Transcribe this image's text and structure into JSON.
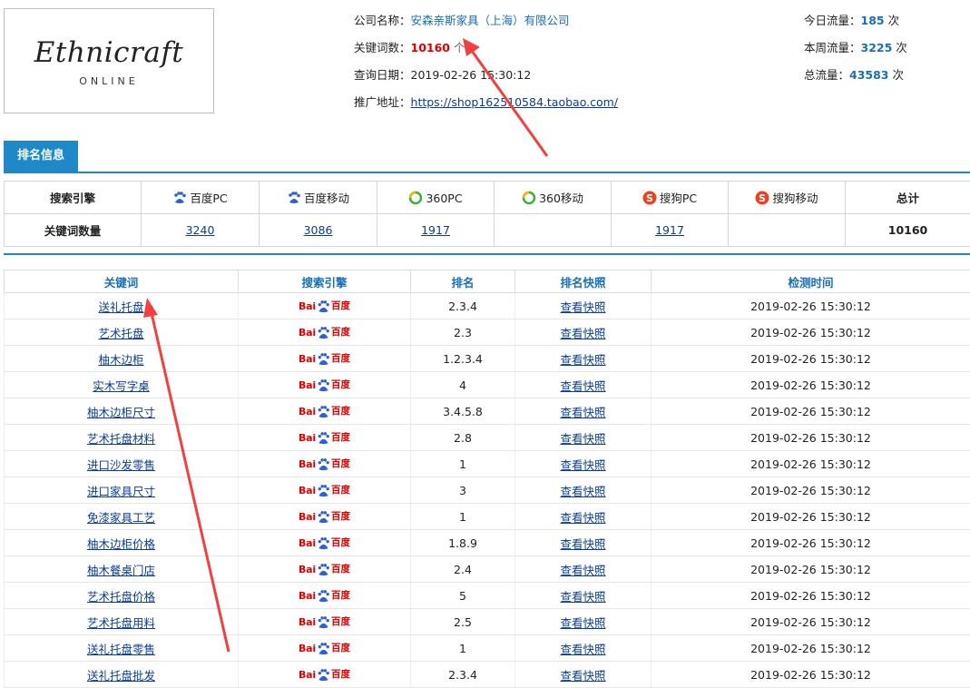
{
  "logo": {
    "line1": "Ethnicraft",
    "line2": "ONLINE"
  },
  "info": {
    "company_label": "公司名称：",
    "company": "安森亲斯家具（上海）有限公司",
    "kw_label": "关键词数：",
    "kw_count": "10160",
    "kw_unit": "个",
    "date_label": "查询日期：",
    "date": "2019-02-26 15:30:12",
    "url_label": "推广地址：",
    "url": "https://shop162510584.taobao.com/"
  },
  "traffic": {
    "today_label": "今日流量：",
    "today": "185",
    "today_unit": "次",
    "week_label": "本周流量：",
    "week": "3225",
    "week_unit": "次",
    "total_label": "总流量：",
    "total": "43583",
    "total_unit": "次"
  },
  "tab": {
    "label": "排名信息"
  },
  "engines": {
    "header_label": "搜索引擎",
    "count_label": "关键词数量",
    "cols": [
      {
        "name": "百度PC",
        "icon": "baidu-paw-icon",
        "count": "3240"
      },
      {
        "name": "百度移动",
        "icon": "baidu-paw-icon",
        "count": "3086"
      },
      {
        "name": "360PC",
        "icon": "360-icon",
        "count": "1917"
      },
      {
        "name": "360移动",
        "icon": "360-icon",
        "count": ""
      },
      {
        "name": "搜狗PC",
        "icon": "sogou-icon",
        "count": "1917"
      },
      {
        "name": "搜狗移动",
        "icon": "sogou-icon",
        "count": ""
      }
    ],
    "total_label": "总计",
    "total": "10160"
  },
  "kw_table": {
    "headers": [
      "关键词",
      "搜索引擎",
      "排名",
      "排名快照",
      "检测时间"
    ],
    "engine_logo": {
      "bai": "Bai",
      "du": "百度"
    },
    "snapshot_label": "查看快照",
    "rows": [
      {
        "kw": "送礼托盘",
        "rank": "2.3.4",
        "time": "2019-02-26 15:30:12"
      },
      {
        "kw": "艺术托盘",
        "rank": "2.3",
        "time": "2019-02-26 15:30:12"
      },
      {
        "kw": "柚木边柜",
        "rank": "1.2.3.4",
        "time": "2019-02-26 15:30:12"
      },
      {
        "kw": "实木写字桌",
        "rank": "4",
        "time": "2019-02-26 15:30:12"
      },
      {
        "kw": "柚木边柜尺寸",
        "rank": "3.4.5.8",
        "time": "2019-02-26 15:30:12"
      },
      {
        "kw": "艺术托盘材料",
        "rank": "2.8",
        "time": "2019-02-26 15:30:12"
      },
      {
        "kw": "进口沙发零售",
        "rank": "1",
        "time": "2019-02-26 15:30:12"
      },
      {
        "kw": "进口家具尺寸",
        "rank": "3",
        "time": "2019-02-26 15:30:12"
      },
      {
        "kw": "免漆家具工艺",
        "rank": "1",
        "time": "2019-02-26 15:30:12"
      },
      {
        "kw": "柚木边柜价格",
        "rank": "1.8.9",
        "time": "2019-02-26 15:30:12"
      },
      {
        "kw": "柚木餐桌门店",
        "rank": "2.4",
        "time": "2019-02-26 15:30:12"
      },
      {
        "kw": "艺术托盘价格",
        "rank": "5",
        "time": "2019-02-26 15:30:12"
      },
      {
        "kw": "艺术托盘用料",
        "rank": "2.5",
        "time": "2019-02-26 15:30:12"
      },
      {
        "kw": "送礼托盘零售",
        "rank": "1",
        "time": "2019-02-26 15:30:12"
      },
      {
        "kw": "送礼托盘批发",
        "rank": "2.3.4",
        "time": "2019-02-26 15:30:12"
      }
    ]
  },
  "colors": {
    "accent": "#1e88c8",
    "highlight": "#e00000",
    "arrow": "#f04040"
  }
}
